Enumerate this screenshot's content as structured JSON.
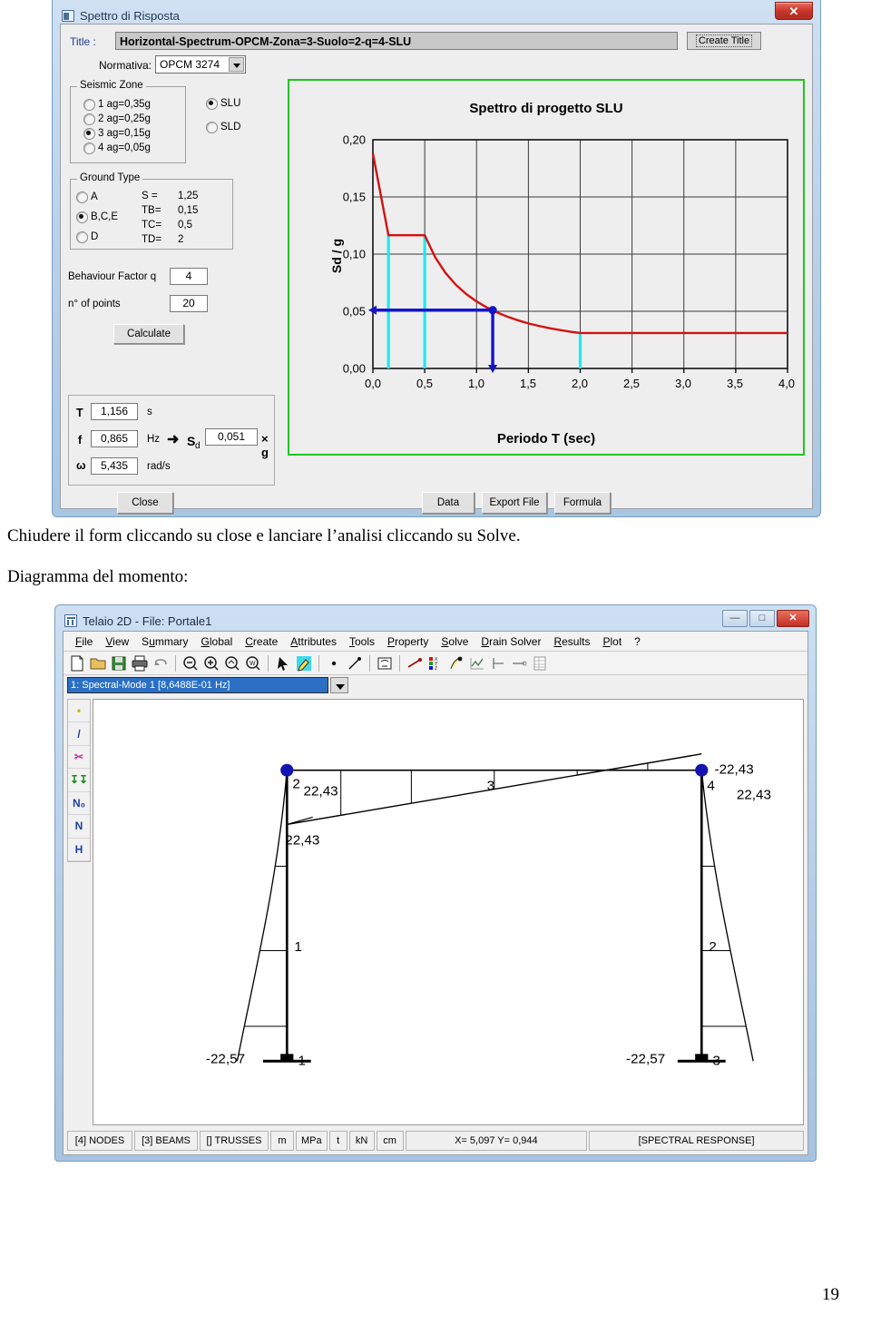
{
  "window1": {
    "title": "Spettro di Risposta",
    "close_label": "✕",
    "title_field_label": "Title :",
    "title_field_value": "Horizontal-Spectrum-OPCM-Zona=3-Suolo=2-q=4-SLU",
    "create_title_button": "Create Title",
    "normativa_label": "Normativa:",
    "normativa_value": "OPCM 3274",
    "seismic_zone": {
      "legend": "Seismic Zone",
      "options": [
        {
          "label": "1 ag=0,35g",
          "selected": false
        },
        {
          "label": "2 ag=0,25g",
          "selected": false
        },
        {
          "label": "3 ag=0,15g",
          "selected": true
        },
        {
          "label": "4 ag=0,05g",
          "selected": false
        }
      ]
    },
    "limit_state": {
      "options": [
        {
          "label": "SLU",
          "selected": true
        },
        {
          "label": "SLD",
          "selected": false
        }
      ]
    },
    "ground_type": {
      "legend": "Ground Type",
      "options": [
        {
          "label": "A",
          "selected": false
        },
        {
          "label": "B,C,E",
          "selected": true
        },
        {
          "label": "D",
          "selected": false
        }
      ],
      "params": [
        {
          "name": "S  =",
          "value": "1,25"
        },
        {
          "name": "TB=",
          "value": "0,15"
        },
        {
          "name": "TC=",
          "value": "0,5"
        },
        {
          "name": "TD=",
          "value": "2"
        }
      ]
    },
    "behaviour_factor_label": "Behaviour Factor q",
    "behaviour_factor_value": "4",
    "n_points_label": "n° of points",
    "n_points_value": "20",
    "calculate_button": "Calculate",
    "results": {
      "T_symbol": "T",
      "T_value": "1,156",
      "T_unit": "s",
      "f_symbol": "f",
      "f_value": "0,865",
      "f_unit": "Hz",
      "w_symbol": "ω",
      "w_value": "5,435",
      "w_unit": "rad/s",
      "arrow": "➜",
      "sd_symbol": "S",
      "sd_sub": "d",
      "sd_value": "0,051",
      "sd_unit": "× g"
    },
    "buttons": {
      "close": "Close",
      "data": "Data",
      "export_file": "Export File",
      "formula": "Formula"
    }
  },
  "chart_data": {
    "type": "line",
    "title": "Spettro di progetto SLU",
    "xlabel": "Periodo T (sec)",
    "ylabel": "Sd / g",
    "xlim": [
      0.0,
      4.0
    ],
    "ylim": [
      0.0,
      0.2
    ],
    "xticks": [
      "0,0",
      "0,5",
      "1,0",
      "1,5",
      "2,0",
      "2,5",
      "3,0",
      "3,5",
      "4,0"
    ],
    "xtick_values": [
      0.0,
      0.5,
      1.0,
      1.5,
      2.0,
      2.5,
      3.0,
      3.5,
      4.0
    ],
    "yticks": [
      "0,00",
      "0,05",
      "0,10",
      "0,15",
      "0,20"
    ],
    "ytick_values": [
      0.0,
      0.05,
      0.1,
      0.15,
      0.2
    ],
    "grid": true,
    "series": [
      {
        "name": "Spettro di progetto SLU",
        "color": "#d41111",
        "x": [
          0.0,
          0.15,
          0.5,
          0.6,
          0.7,
          0.8,
          0.9,
          1.0,
          1.1,
          1.156,
          1.2,
          1.3,
          1.4,
          1.5,
          1.6,
          1.7,
          1.8,
          1.9,
          2.0,
          2.5,
          3.0,
          3.5,
          4.0
        ],
        "y": [
          0.188,
          0.1165,
          0.1165,
          0.0974,
          0.0836,
          0.0732,
          0.0651,
          0.0586,
          0.0533,
          0.051,
          0.0489,
          0.0452,
          0.0421,
          0.0394,
          0.0372,
          0.0353,
          0.0337,
          0.0322,
          0.031,
          0.031,
          0.031,
          0.031,
          0.031
        ]
      }
    ],
    "markers": {
      "color": "#1414c8",
      "T": 1.156,
      "Sd": 0.051,
      "label": "design point T=1,156 s ; Sd/g=0,051"
    },
    "vertical_guides": {
      "color": "#22e8f0",
      "values": [
        0.15,
        0.5,
        2.0
      ],
      "names": [
        "TB",
        "TC",
        "TD"
      ]
    }
  },
  "doc": {
    "line1": "Chiudere il form cliccando su close e lanciare l’analisi cliccando su Solve.",
    "line2": "Diagramma del momento:",
    "page_number": "19"
  },
  "window2": {
    "title": "Telaio 2D - File: Portale1",
    "window_buttons": {
      "minimize": "—",
      "maximize": "□",
      "close": "✕"
    },
    "menu": [
      {
        "label": "File",
        "accel": "F"
      },
      {
        "label": "View",
        "accel": "V"
      },
      {
        "label": "Summary",
        "accel": "u"
      },
      {
        "label": "Global",
        "accel": "G"
      },
      {
        "label": "Create",
        "accel": "C"
      },
      {
        "label": "Attributes",
        "accel": "A"
      },
      {
        "label": "Tools",
        "accel": "T"
      },
      {
        "label": "Property",
        "accel": "P"
      },
      {
        "label": "Solve",
        "accel": "S"
      },
      {
        "label": "Drain Solver",
        "accel": "D"
      },
      {
        "label": "Results",
        "accel": "R"
      },
      {
        "label": "Plot",
        "accel": "P"
      },
      {
        "label": "?",
        "accel": ""
      }
    ],
    "toolbar_icons": [
      "new-file-icon",
      "open-folder-icon",
      "save-disk-icon",
      "print-icon",
      "undo-icon",
      "zoom-out-icon",
      "zoom-in-icon",
      "zoom-pan-icon",
      "zoom-window-icon",
      "select-arrow-icon",
      "paint-icon",
      "node-point-icon",
      "beam-line-icon",
      "mask-icon",
      "support-icon",
      "rgb-axes-icon",
      "load-icon",
      "chart-icon",
      "fix-left-icon",
      "release-icon",
      "table-icon"
    ],
    "mode_combo_value": "1: Spectral-Mode 1 [8,6488E-01 Hz]",
    "vertical_toolbar": [
      {
        "name": "node-icon",
        "label": "•"
      },
      {
        "name": "beam-icon",
        "label": "/"
      },
      {
        "name": "cut-scissors-icon",
        "label": "✂"
      },
      {
        "name": "loads-icon",
        "label": "↧↧"
      },
      {
        "name": "axial-n0-icon",
        "label": "N₀"
      },
      {
        "name": "axial-n-icon",
        "label": "N"
      },
      {
        "name": "horizontal-h-icon",
        "label": "H"
      }
    ],
    "diagram": {
      "node_labels": [
        "1",
        "2",
        "3",
        "4"
      ],
      "member_labels": [
        "1",
        "2",
        "3"
      ],
      "values": {
        "beam_left_top": "22,43",
        "beam_left_under": "22,43",
        "beam_right_top": "-22,43",
        "beam_right_side": "22,43",
        "base_left": "-22,57",
        "base_right": "-22,57"
      }
    },
    "statusbar": [
      "[4] NODES",
      "[3] BEAMS",
      "[] TRUSSES",
      "m",
      "MPa",
      "t",
      "kN",
      "cm",
      "X= 5,097   Y= 0,944",
      "[SPECTRAL RESPONSE]"
    ]
  }
}
